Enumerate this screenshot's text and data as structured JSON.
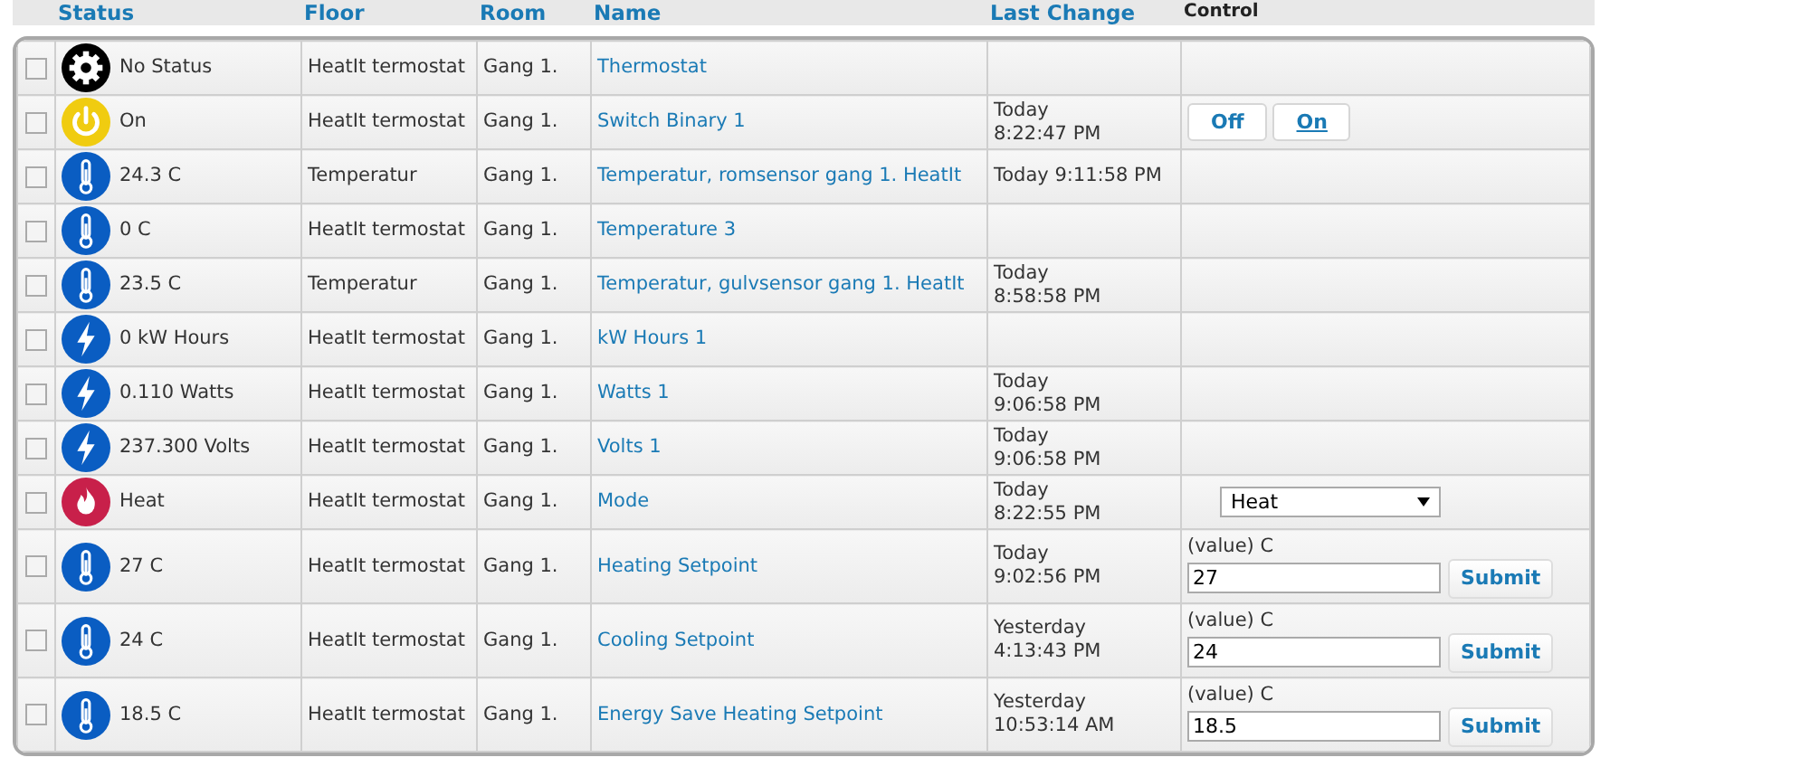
{
  "columns": [
    {
      "label": "Status",
      "kind": "link"
    },
    {
      "label": "Floor",
      "kind": "link"
    },
    {
      "label": "Room",
      "kind": "link"
    },
    {
      "label": "Name",
      "kind": "link"
    },
    {
      "label": "Last Change",
      "kind": "link"
    },
    {
      "label": "Control",
      "kind": "plain"
    }
  ],
  "rows": [
    {
      "checked": false,
      "kind": "gear",
      "status": "No Status",
      "floor": "HeatIt termostat",
      "room": "Gang 1.",
      "name": "Thermostat",
      "last_change": [],
      "control": {
        "kind": "none"
      }
    },
    {
      "checked": false,
      "kind": "power",
      "status": "On",
      "floor": "HeatIt termostat",
      "room": "Gang 1.",
      "name": "Switch Binary 1",
      "last_change": [
        "Today",
        "8:22:47 PM"
      ],
      "control": {
        "kind": "onoff",
        "buttons": [
          {
            "label": "Off",
            "selected": false
          },
          {
            "label": "On",
            "selected": true
          }
        ]
      }
    },
    {
      "checked": false,
      "kind": "thermometer",
      "status": "24.3 C",
      "floor": "Temperatur",
      "room": "Gang 1.",
      "name": "Temperatur, romsensor gang 1. HeatIt",
      "last_change": [
        "Today 9:11:58 PM"
      ],
      "control": {
        "kind": "none"
      }
    },
    {
      "checked": false,
      "kind": "thermometer",
      "status": "0 C",
      "floor": "HeatIt termostat",
      "room": "Gang 1.",
      "name": "Temperature 3",
      "last_change": [],
      "control": {
        "kind": "none"
      }
    },
    {
      "checked": false,
      "kind": "thermometer",
      "status": "23.5 C",
      "floor": "Temperatur",
      "room": "Gang 1.",
      "name": "Temperatur, gulvsensor gang 1. HeatIt",
      "last_change": [
        "Today",
        "8:58:58 PM"
      ],
      "control": {
        "kind": "none"
      }
    },
    {
      "checked": false,
      "kind": "bolt",
      "status": "0 kW Hours",
      "floor": "HeatIt termostat",
      "room": "Gang 1.",
      "name": "kW Hours 1",
      "last_change": [],
      "control": {
        "kind": "none"
      }
    },
    {
      "checked": false,
      "kind": "bolt",
      "status": "0.110 Watts",
      "floor": "HeatIt termostat",
      "room": "Gang 1.",
      "name": "Watts 1",
      "last_change": [
        "Today",
        "9:06:58 PM"
      ],
      "control": {
        "kind": "none"
      }
    },
    {
      "checked": false,
      "kind": "bolt",
      "status": "237.300 Volts",
      "floor": "HeatIt termostat",
      "room": "Gang 1.",
      "name": "Volts 1",
      "last_change": [
        "Today",
        "9:06:58 PM"
      ],
      "control": {
        "kind": "none"
      }
    },
    {
      "checked": false,
      "kind": "flame",
      "status": "Heat",
      "floor": "HeatIt termostat",
      "room": "Gang 1.",
      "name": "Mode",
      "last_change": [
        "Today",
        "8:22:55 PM"
      ],
      "control": {
        "kind": "select",
        "value": "Heat"
      }
    },
    {
      "checked": false,
      "kind": "thermometer",
      "status": "27 C",
      "floor": "HeatIt termostat",
      "room": "Gang 1.",
      "name": "Heating Setpoint",
      "last_change": [
        "Today",
        "9:02:56 PM"
      ],
      "control": {
        "kind": "setpoint",
        "label": "(value) C",
        "value": "27",
        "button": "Submit"
      }
    },
    {
      "checked": false,
      "kind": "thermometer",
      "status": "24 C",
      "floor": "HeatIt termostat",
      "room": "Gang 1.",
      "name": "Cooling Setpoint",
      "last_change": [
        "Yesterday",
        "4:13:43 PM"
      ],
      "control": {
        "kind": "setpoint",
        "label": "(value) C",
        "value": "24",
        "button": "Submit"
      }
    },
    {
      "checked": false,
      "kind": "thermometer",
      "status": "18.5 C",
      "floor": "HeatIt termostat",
      "room": "Gang 1.",
      "name": "Energy Save Heating Setpoint",
      "last_change": [
        "Yesterday",
        "10:53:14 AM"
      ],
      "control": {
        "kind": "setpoint",
        "label": "(value) C",
        "value": "18.5",
        "button": "Submit"
      }
    }
  ]
}
